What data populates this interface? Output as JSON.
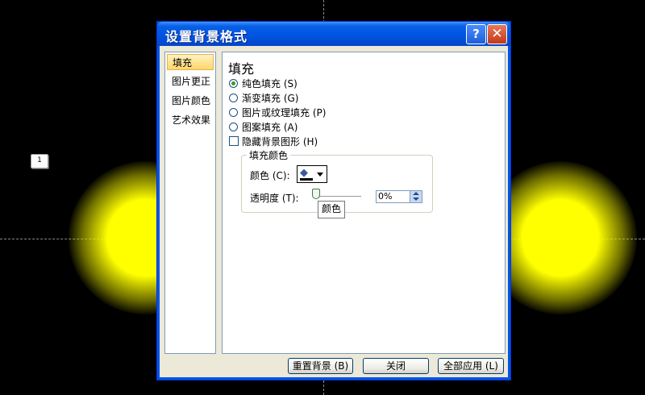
{
  "slide": {
    "slide_number": "1"
  },
  "dialog": {
    "title": "设置背景格式",
    "help_glyph": "?",
    "close_glyph": "✕"
  },
  "nav": {
    "items": [
      {
        "label": "填充",
        "selected": true
      },
      {
        "label": "图片更正",
        "selected": false
      },
      {
        "label": "图片颜色",
        "selected": false
      },
      {
        "label": "艺术效果",
        "selected": false
      }
    ]
  },
  "fill": {
    "heading": "填充",
    "options": [
      {
        "label": "纯色填充 (S)",
        "checked": true
      },
      {
        "label": "渐变填充 (G)",
        "checked": false
      },
      {
        "label": "图片或纹理填充 (P)",
        "checked": false
      },
      {
        "label": "图案填充 (A)",
        "checked": false
      }
    ],
    "hide_background_label": "隐藏背景图形 (H)",
    "hide_background_checked": false
  },
  "fill_color": {
    "group_title": "填充颜色",
    "color_label": "颜色 (C):",
    "transparency_label": "透明度 (T):",
    "transparency_value": "0%",
    "tooltip": "颜色",
    "selected_color": "#000000"
  },
  "buttons": {
    "reset": "重置背景 (B)",
    "close": "关闭",
    "apply_all": "全部应用 (L)"
  }
}
